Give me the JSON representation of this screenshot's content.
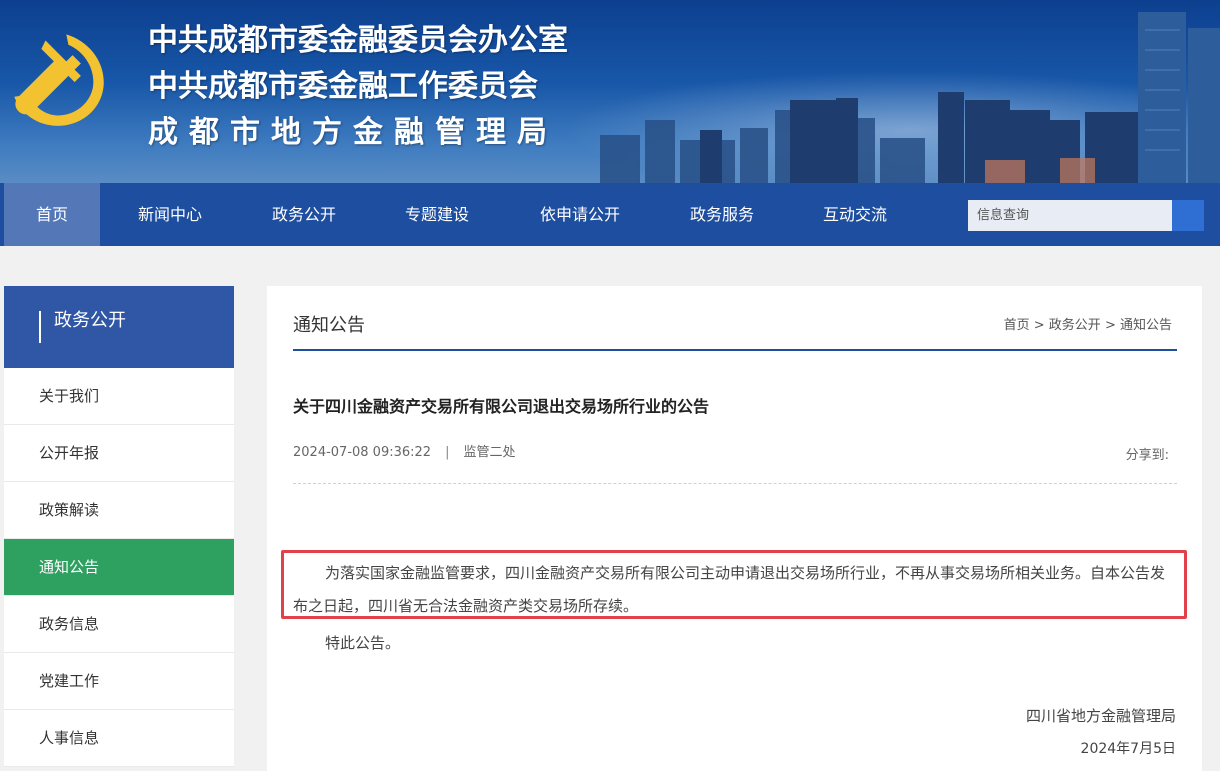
{
  "banner": {
    "title_lines": [
      "中共成都市委金融委员会办公室",
      "中共成都市委金融工作委员会",
      "成都市地方金融管理局"
    ]
  },
  "nav": {
    "items": [
      "首页",
      "新闻中心",
      "政务公开",
      "专题建设",
      "依申请公开",
      "政务服务",
      "互动交流"
    ],
    "active": "首页",
    "search_placeholder": "信息查询"
  },
  "sidebar": {
    "title": "政务公开",
    "items": [
      "关于我们",
      "公开年报",
      "政策解读",
      "通知公告",
      "政务信息",
      "党建工作",
      "人事信息"
    ],
    "active": "通知公告"
  },
  "main": {
    "section_title": "通知公告",
    "breadcrumb": [
      "首页",
      "政务公开",
      "通知公告"
    ],
    "breadcrumb_sep": " > ",
    "article": {
      "title": "关于四川金融资产交易所有限公司退出交易场所行业的公告",
      "datetime": "2024-07-08 09:36:22",
      "meta_sep": "|",
      "department": "监管二处",
      "share_label": "分享到:",
      "paragraph1": "为落实国家金融监管要求，四川金融资产交易所有限公司主动申请退出交易场所行业，不再从事交易场所相关业务。自本公告发布之日起，四川省无合法金融资产类交易场所存续。",
      "paragraph2": "特此公告。",
      "signature_org": "四川省地方金融管理局",
      "signature_date": "2024年7月5日"
    }
  },
  "colors": {
    "nav_bg": "#1e4ea0",
    "nav_active": "#5377b7",
    "sidebar_head": "#2f57a6",
    "sidebar_active": "#2ea160",
    "highlight_border": "#e0414a"
  }
}
